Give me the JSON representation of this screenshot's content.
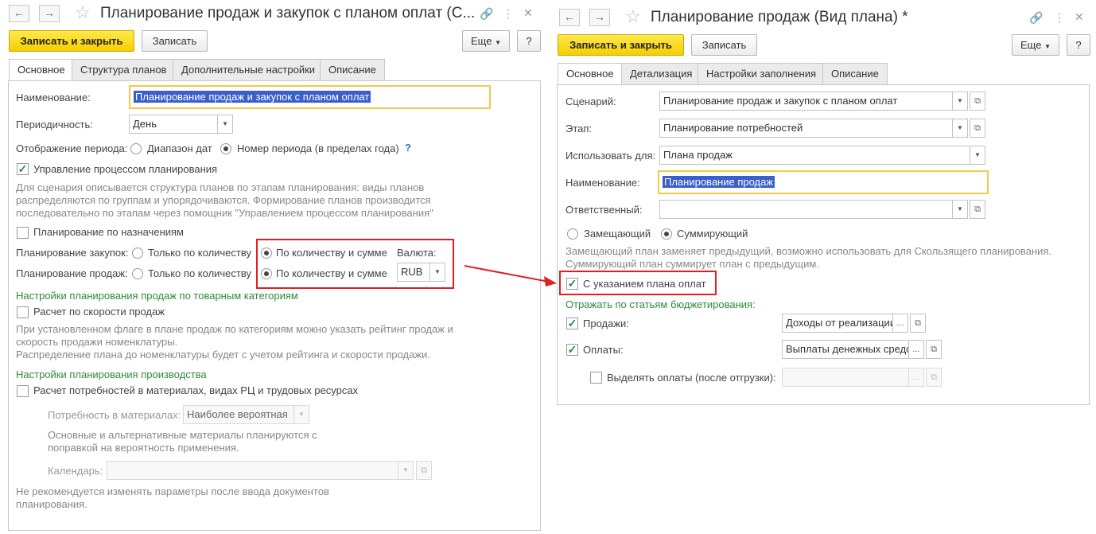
{
  "left": {
    "title": "Планирование продаж и закупок с планом оплат (С...",
    "buttons": {
      "save_close": "Записать и закрыть",
      "save": "Записать",
      "more": "Еще",
      "help": "?"
    },
    "tabs": [
      "Основное",
      "Структура планов",
      "Дополнительные настройки",
      "Описание"
    ],
    "name": {
      "label": "Наименование:",
      "value": "Планирование продаж и закупок с планом оплат"
    },
    "periodicity": {
      "label": "Периодичность:",
      "value": "День"
    },
    "period_display": {
      "label": "Отображение периода:",
      "opt1": "Диапазон дат",
      "opt2": "Номер периода (в пределах года)",
      "help": "?"
    },
    "process_mgmt": {
      "label": "Управление процессом планирования",
      "note": "Для сценария описывается структура планов по этапам планирования: виды планов распределяются по группам и упорядочиваются. Формирование планов производится последовательно по этапам через помощник \"Управлением процессом планирования\""
    },
    "by_assignment": {
      "label": "Планирование по назначениям"
    },
    "purchase": {
      "label": "Планирование закупок:",
      "opt1": "Только по количеству",
      "opt2": "По количеству и сумме"
    },
    "sales": {
      "label": "Планирование продаж:",
      "opt1": "Только по количеству",
      "opt2": "По количеству и сумме"
    },
    "currency": {
      "label": "Валюта:",
      "value": "RUB"
    },
    "cat_section": {
      "title": "Настройки планирования продаж по товарным категориям",
      "speed_label": "Расчет по скорости продаж",
      "note1": "При установленном флаге в плане продаж по категориям можно указать рейтинг продаж и скорость продажи номенклатуры.",
      "note2": "Распределение плана до номенклатуры будет с учетом рейтинга и скорости продажи."
    },
    "prod_section": {
      "title": "Настройки планирования производства",
      "needs_label": "Расчет потребностей в материалах, видах РЦ и трудовых ресурсах",
      "materials_label": "Потребность в материалах:",
      "materials_value": "Наиболее вероятная",
      "materials_note": "Основные и альтернативные материалы планируются с поправкой на вероятность применения.",
      "calendar_label": "Календарь:"
    },
    "footer_note": "Не рекомендуется изменять параметры после ввода документов планирования."
  },
  "right": {
    "title": "Планирование продаж (Вид плана) *",
    "buttons": {
      "save_close": "Записать и закрыть",
      "save": "Записать",
      "more": "Еще",
      "help": "?"
    },
    "tabs": [
      "Основное",
      "Детализация",
      "Настройки заполнения",
      "Описание"
    ],
    "scenario": {
      "label": "Сценарий:",
      "value": "Планирование продаж и закупок с планом оплат"
    },
    "stage": {
      "label": "Этап:",
      "value": "Планирование потребностей"
    },
    "use_for": {
      "label": "Использовать для:",
      "value": "Плана продаж"
    },
    "name": {
      "label": "Наименование:",
      "value": "Планирование продаж"
    },
    "responsible": {
      "label": "Ответственный:",
      "value": ""
    },
    "mode": {
      "opt1": "Замещающий",
      "opt2": "Суммирующий",
      "note": "Замещающий план заменяет предыдущий, возможно использовать для Скользящего планирования. Суммирующий план суммирует план с предыдущим."
    },
    "payment_plan": {
      "label": "С указанием плана оплат"
    },
    "budget": {
      "title": "Отражать по статьям бюджетирования:",
      "sales_label": "Продажи:",
      "sales_value": "Доходы от реализации",
      "payments_label": "Оплаты:",
      "payments_value": "Выплаты денежных средств",
      "separate_label": "Выделять оплаты (после отгрузки):",
      "separate_value": ""
    }
  },
  "colors": {
    "primary": "#f5cf00",
    "highlight": "#e02020",
    "green_title": "#2f8a3a",
    "selection": "#3a5fc9"
  }
}
